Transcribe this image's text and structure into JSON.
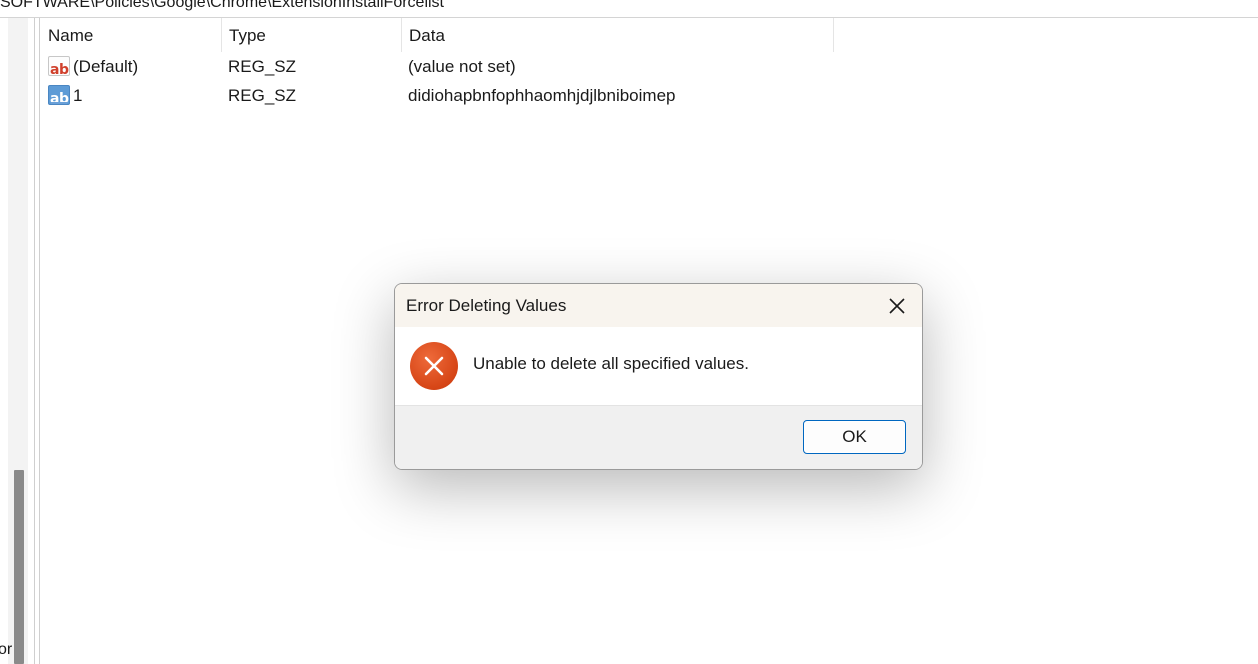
{
  "address": {
    "path": "SOFTWARE\\Policies\\Google\\Chrome\\ExtensionInstallForcelist"
  },
  "tree": {
    "partial_label": "or"
  },
  "list": {
    "columns": [
      "Name",
      "Type",
      "Data"
    ],
    "rows": [
      {
        "name": "(Default)",
        "type": "REG_SZ",
        "data": "(value not set)",
        "icon": "reg-string-icon"
      },
      {
        "name": "1",
        "type": "REG_SZ",
        "data": "didiohapbnfophhaomhjdjlbniboimep",
        "icon": "reg-string-icon-selected"
      }
    ]
  },
  "dialog": {
    "title": "Error Deleting Values",
    "message": "Unable to delete all specified values.",
    "ok_label": "OK",
    "icon": "error-icon",
    "close_icon": "close-icon"
  },
  "colors": {
    "error": "#d64516",
    "accent": "#0067c0",
    "titlebar": "#f8f4ee"
  }
}
